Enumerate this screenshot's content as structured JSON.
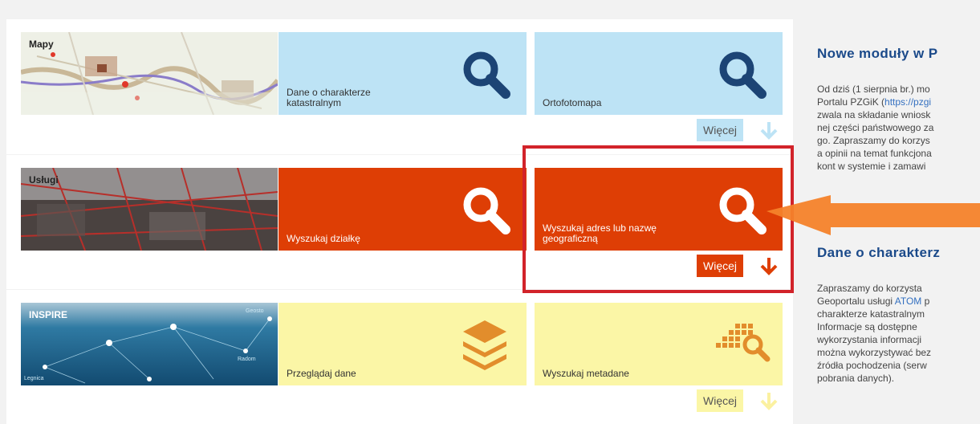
{
  "rows": [
    {
      "section_label": "Mapy",
      "tiles": [
        {
          "label": "Dane o charakterze katastralnym",
          "icon": "search-icon"
        },
        {
          "label": "Ortofotomapa",
          "icon": "search-icon"
        }
      ],
      "more_label": "Więcej"
    },
    {
      "section_label": "Usługi",
      "tiles": [
        {
          "label": "Wyszukaj działkę",
          "icon": "search-icon"
        },
        {
          "label": "Wyszukaj adres lub nazwę geograficzną",
          "icon": "search-icon"
        }
      ],
      "more_label": "Więcej"
    },
    {
      "section_label": "INSPIRE",
      "tiles": [
        {
          "label": "Przeglądaj dane",
          "icon": "layers-icon"
        },
        {
          "label": "Wyszukaj metadane",
          "icon": "metadata-search-icon"
        }
      ],
      "more_label": "Więcej"
    }
  ],
  "news": {
    "item1_title": "Nowe moduły w P",
    "item1_body_1": "Od dziś (1 sierpnia br.) mo",
    "item1_body_2": "Portalu PZGiK (",
    "item1_link": "https://pzgi",
    "item1_body_3": "zwala na składanie wniosk",
    "item1_body_4": "nej części państwowego za",
    "item1_body_5": "go. Zapraszamy do korzys",
    "item1_body_6": "a opinii na temat funkcjona",
    "item1_body_7": "kont w systemie i zamawi",
    "item2_title": "Dane o charakterz",
    "item2_body_1": "Zapraszamy do korzysta",
    "item2_body_2a": "Geoportalu usługi ",
    "item2_link": "ATOM",
    "item2_body_2b": " p",
    "item2_body_3": "charakterze katastralnym",
    "item2_body_4": "Informacje są dostępne",
    "item2_body_5": "wykorzystania informacji",
    "item2_body_6": "można wykorzystywać bez",
    "item2_body_7": "źródła pochodzenia (serw",
    "item2_body_8": "pobrania danych)."
  },
  "thumb_text": {
    "inspire_city_1": "Legnica",
    "inspire_city_2": "Radom",
    "inspire_city_3": "Geosto"
  },
  "colors": {
    "light_blue": "#bde3f5",
    "orange_red": "#de3e05",
    "light_yellow": "#fbf6a6",
    "icon_navy": "#1c4475",
    "icon_orange": "#e28d2c",
    "highlight_red": "#d2232a",
    "pointer_orange": "#f4822a"
  }
}
